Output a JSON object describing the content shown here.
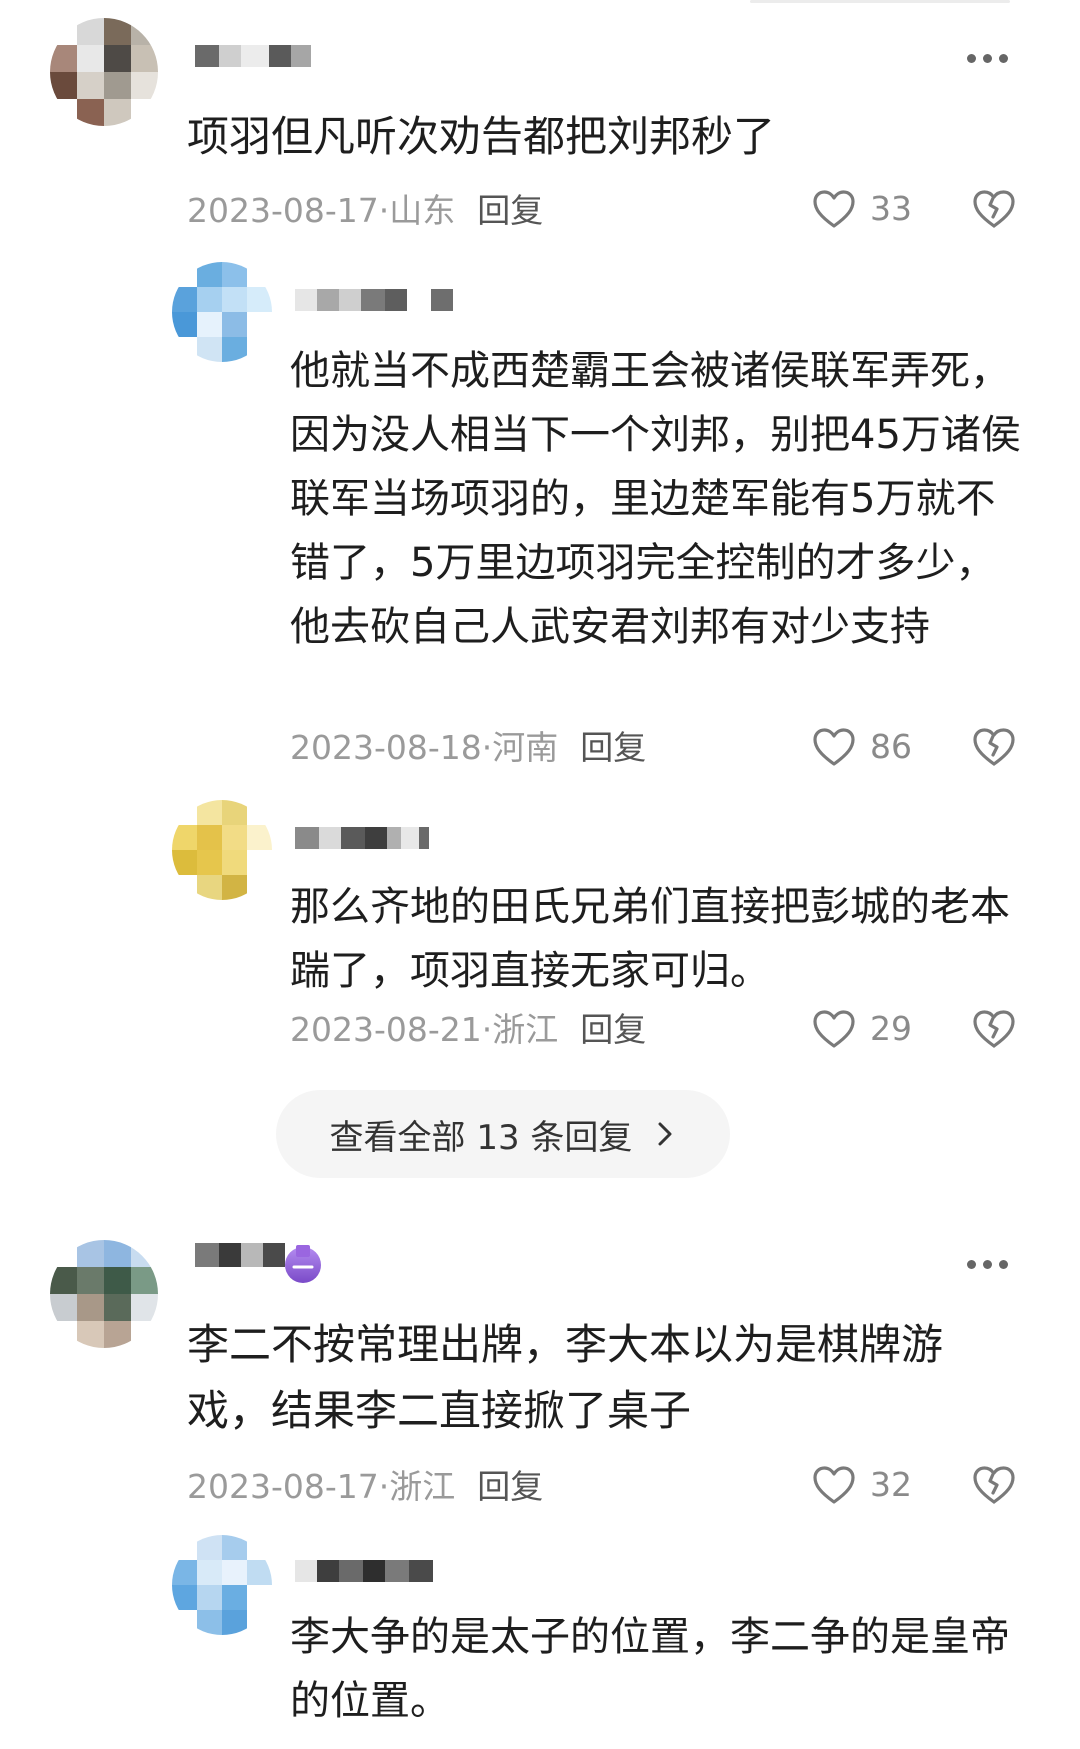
{
  "comments": [
    {
      "username_hidden": true,
      "text": "项羽但凡听次劝告都把刘邦秒了",
      "date": "2023-08-17",
      "location": "山东",
      "reply_label": "回复",
      "likes": "33"
    },
    {
      "username_hidden": true,
      "text": "他就当不成西楚霸王会被诸侯联军弄死，因为没人相当下一个刘邦，别把45万诸侯联军当场项羽的，里边楚军能有5万就不错了，5万里边项羽完全控制的才多少，他去砍自己人武安君刘邦有对少支持",
      "date": "2023-08-18",
      "location": "河南",
      "reply_label": "回复",
      "likes": "86"
    },
    {
      "username_hidden": true,
      "text": "那么齐地的田氏兄弟们直接把彭城的老本踹了，项羽直接无家可归。",
      "date": "2023-08-21",
      "location": "浙江",
      "reply_label": "回复",
      "likes": "29"
    },
    {
      "username_hidden": true,
      "text": "李二不按常理出牌，李大本以为是棋牌游戏，结果李二直接掀了桌子",
      "date": "2023-08-17",
      "location": "浙江",
      "reply_label": "回复",
      "likes": "32"
    },
    {
      "username_hidden": true,
      "text": "李大争的是太子的位置，李二争的是皇帝的位置。",
      "date": "",
      "location": "",
      "reply_label": "",
      "likes": ""
    }
  ],
  "view_all_label": "查看全部 13 条回复",
  "meta_separator": " · ",
  "icons": {
    "more": "more-icon",
    "like": "heart-icon",
    "dislike": "broken-heart-icon",
    "chevron": "chevron-right-icon",
    "badge": "purple-badge-icon"
  },
  "colors": {
    "text": "#1e1e1e",
    "meta": "#9a9a9a",
    "pill_bg": "#f5f5f5"
  }
}
